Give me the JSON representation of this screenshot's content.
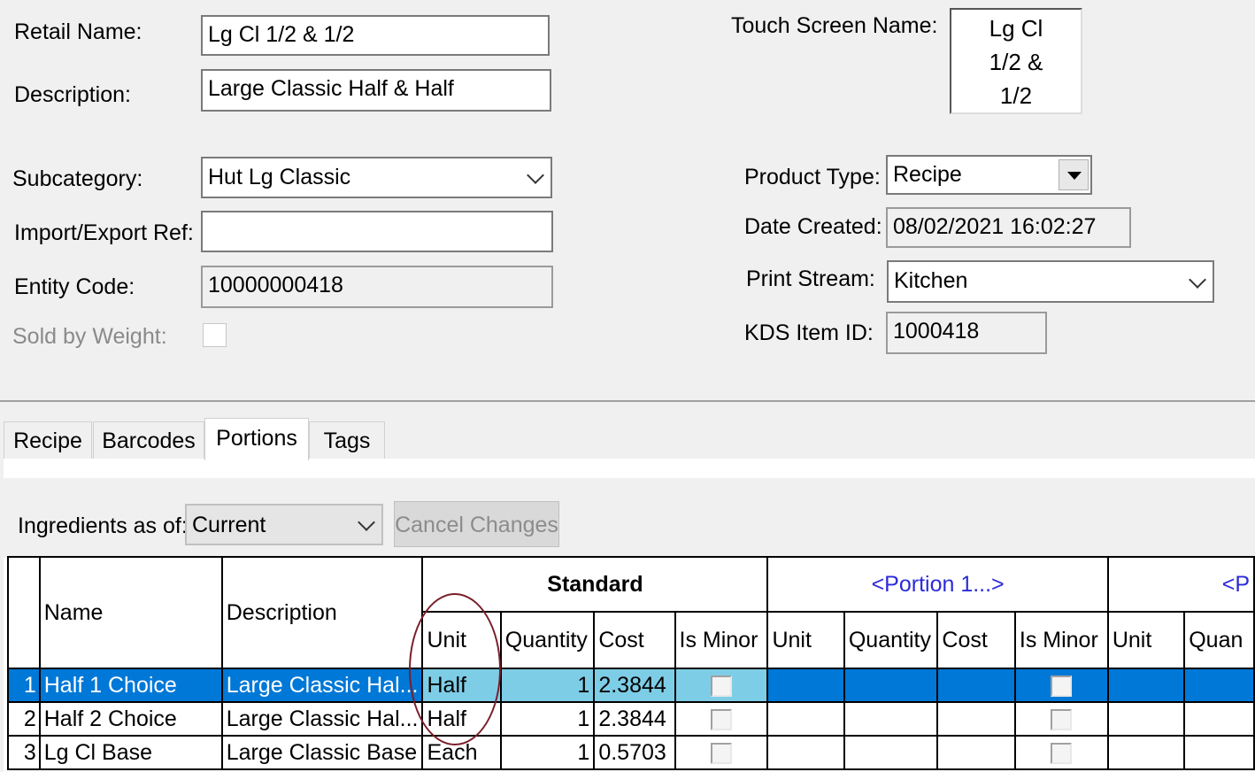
{
  "form": {
    "retail_name_label": "Retail Name:",
    "retail_name_value": "Lg Cl 1/2 & 1/2",
    "description_label": "Description:",
    "description_value": "Large Classic Half & Half",
    "subcategory_label": "Subcategory:",
    "subcategory_value": "Hut Lg Classic",
    "import_export_label": "Import/Export Ref:",
    "import_export_value": "",
    "entity_code_label": "Entity Code:",
    "entity_code_value": "10000000418",
    "sold_by_weight_label": "Sold by Weight:",
    "touch_screen_label": "Touch Screen Name:",
    "touch_screen_lines": [
      "Lg Cl",
      "1/2 &",
      "1/2"
    ],
    "product_type_label": "Product Type:",
    "product_type_value": "Recipe",
    "date_created_label": "Date Created:",
    "date_created_value": "08/02/2021 16:02:27",
    "print_stream_label": "Print Stream:",
    "print_stream_value": "Kitchen",
    "kds_label": "KDS Item ID:",
    "kds_value": "1000418"
  },
  "tabs": [
    "Recipe",
    "Barcodes",
    "Portions",
    "Tags"
  ],
  "active_tab": "Portions",
  "portions": {
    "ingredients_label": "Ingredients as of:",
    "ingredients_value": "Current",
    "cancel_label": "Cancel Changes",
    "headers": {
      "name": "Name",
      "description": "Description",
      "standard": "Standard",
      "portion1": "<Portion 1...>",
      "portion2": "<P",
      "unit": "Unit",
      "quantity": "Quantity",
      "cost": "Cost",
      "is_minor": "Is Minor",
      "quantity_cut": "Quan"
    },
    "rows": [
      {
        "num": "1",
        "name": "Half 1 Choice",
        "description": "Large Classic Hal...",
        "unit": "Half",
        "quantity": "1",
        "cost": "2.3844",
        "selected": true
      },
      {
        "num": "2",
        "name": "Half 2 Choice",
        "description": "Large Classic Hal...",
        "unit": "Half",
        "quantity": "1",
        "cost": "2.3844",
        "selected": false
      },
      {
        "num": "3",
        "name": "Lg Cl Base",
        "description": "Large Classic Base",
        "unit": "Each",
        "quantity": "1",
        "cost": "0.5703",
        "selected": false
      }
    ]
  },
  "colors": {
    "selection": "#0078d7",
    "selection_light": "#7ecde6",
    "portion_header": "#2b2bd9",
    "annotation_oval": "#7a1f2a"
  }
}
